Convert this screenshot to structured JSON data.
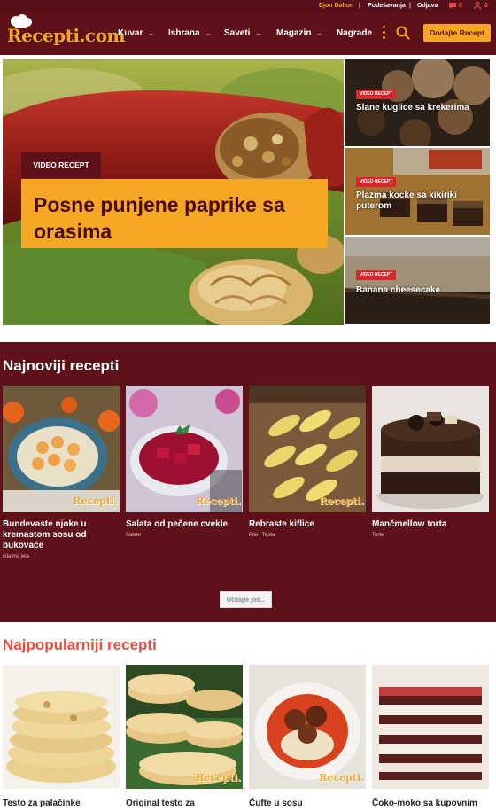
{
  "topbar": {
    "user": "Djon Dalton",
    "settings": "Podešavanja",
    "logout": "Odjava",
    "messages_count": "0",
    "notifications_count": "0"
  },
  "nav": {
    "logo": "Recepti.com",
    "items": [
      {
        "label": "Kuvar"
      },
      {
        "label": "Ishrana"
      },
      {
        "label": "Saveti"
      },
      {
        "label": "Magazin"
      },
      {
        "label": "Nagrade"
      }
    ],
    "add_button": "Dodajte Recept"
  },
  "hero": {
    "main": {
      "badge": "VIDEO RECEPT",
      "title": "Posne punjene paprike sa orasima"
    },
    "side": [
      {
        "badge": "VIDEO RECEPT",
        "title": "Slane kuglice sa krekerima"
      },
      {
        "badge": "VIDEO RECEPT",
        "title": "Plazma kocke sa kikiriki puterom"
      },
      {
        "badge": "VIDEO RECEPT",
        "title": "Banana cheesecake"
      }
    ]
  },
  "newest": {
    "title": "Najnoviji recepti",
    "watermark": "Recepti.",
    "items": [
      {
        "title": "Bundevaste njoke u kremastom sosu od bukovače",
        "category": "Glavna jela"
      },
      {
        "title": "Salata od pečene cvekle",
        "category": "Salate"
      },
      {
        "title": "Rebraste kiflice",
        "category": "Pite i Testa"
      },
      {
        "title": "Mančmellow torta",
        "category": "Torte"
      }
    ],
    "load_more": "Učitajte još..."
  },
  "popular": {
    "title": "Najpopularniji recepti",
    "items": [
      {
        "title": "Testo za palačinke"
      },
      {
        "title": "Original testo za"
      },
      {
        "title": "Ćufte u sosu"
      },
      {
        "title": "Čoko-moko sa kupovnim"
      }
    ]
  },
  "colors": {
    "brand": "#5e1119",
    "accent": "#f5a623",
    "badge_red": "#d9262a",
    "popular_title": "#e84b3c"
  }
}
